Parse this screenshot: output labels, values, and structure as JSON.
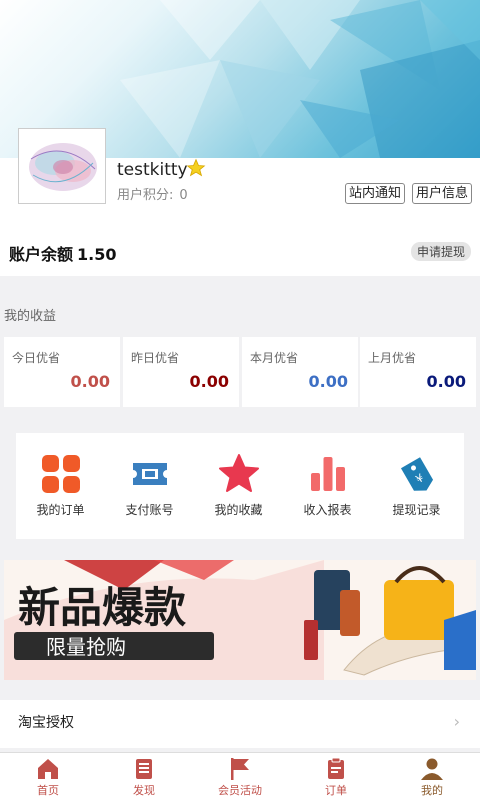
{
  "profile": {
    "username": "testkitty",
    "points_label": "用户积分:",
    "points_value": "0",
    "notice_button": "站内通知",
    "info_button": "用户信息"
  },
  "balance": {
    "label": "账户余额",
    "value": "1.50",
    "withdraw_button": "申请提现"
  },
  "income": {
    "title": "我的收益",
    "cards": [
      {
        "label": "今日优省",
        "value": "0.00",
        "color": "#c0504a"
      },
      {
        "label": "昨日优省",
        "value": "0.00",
        "color": "#8b0000"
      },
      {
        "label": "本月优省",
        "value": "0.00",
        "color": "#3d6fc4"
      },
      {
        "label": "上月优省",
        "value": "0.00",
        "color": "#0a1a7a"
      }
    ]
  },
  "grid": [
    {
      "label": "我的订单",
      "icon": "orders-icon",
      "color": "#f05a28"
    },
    {
      "label": "支付账号",
      "icon": "ticket-icon",
      "color": "#3a7fbf"
    },
    {
      "label": "我的收藏",
      "icon": "star-icon",
      "color": "#e8384f"
    },
    {
      "label": "收入报表",
      "icon": "bar-chart-icon",
      "color": "#f26a6a"
    },
    {
      "label": "提现记录",
      "icon": "price-tag-icon",
      "color": "#1f7fb5"
    }
  ],
  "banner": {
    "headline": "新品爆款",
    "subline": "限量抢购"
  },
  "taobao_row": {
    "label": "淘宝授权"
  },
  "tabbar": [
    {
      "label": "首页",
      "icon": "home-icon"
    },
    {
      "label": "发现",
      "icon": "discover-icon"
    },
    {
      "label": "会员活动",
      "icon": "flag-icon"
    },
    {
      "label": "订单",
      "icon": "order-icon"
    },
    {
      "label": "我的",
      "icon": "user-icon"
    }
  ],
  "colors": {
    "tab_accent": "#c0504a",
    "tab_active": "#8a5a2c"
  }
}
